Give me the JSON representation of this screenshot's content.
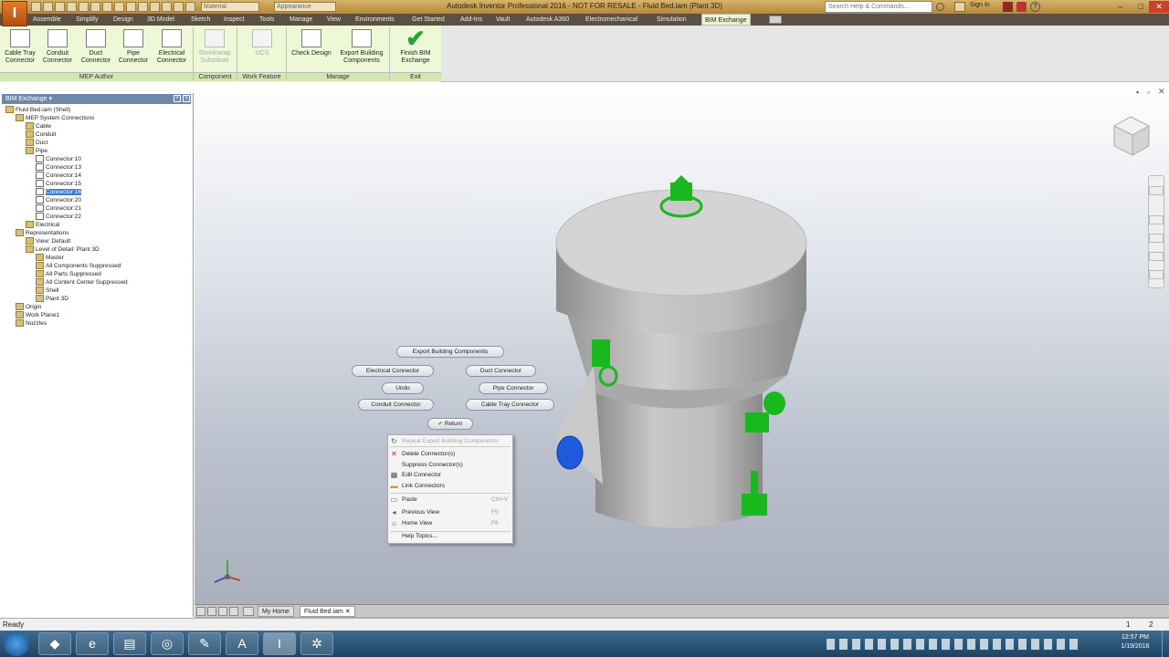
{
  "window": {
    "title": "Autodesk Inventor Professional 2016 - NOT FOR RESALE - Fluid Bed.iam (Plant 3D)",
    "app_icon": "I",
    "search_placeholder": "Search Help & Commands...",
    "sign_in": "Sign In",
    "quick_access": {
      "material": "Material",
      "appearance": "Appearance"
    }
  },
  "menu_tabs": [
    "Assemble",
    "Simplify",
    "Design",
    "3D Model",
    "Sketch",
    "Inspect",
    "Tools",
    "Manage",
    "View",
    "Environments",
    "Get Started",
    "Add-Ins",
    "Vault",
    "Autodesk A360",
    "Electromechanical",
    "Simulation",
    "BIM Exchange"
  ],
  "ribbon": {
    "buttons": [
      {
        "label": "Cable Tray Connector",
        "icon": "cable-tray-icon"
      },
      {
        "label": "Conduit Connector",
        "icon": "conduit-icon"
      },
      {
        "label": "Duct Connector",
        "icon": "duct-icon"
      },
      {
        "label": "Pipe Connector",
        "icon": "pipe-icon"
      },
      {
        "label": "Electrical Connector",
        "icon": "electrical-icon"
      },
      {
        "label": "Shrinkwrap Substitute",
        "icon": "shrinkwrap-icon"
      },
      {
        "label": "UCS",
        "icon": "ucs-icon"
      },
      {
        "label": "Check Design",
        "icon": "check-design-icon"
      },
      {
        "label": "Export Building Components",
        "icon": "export-icon"
      },
      {
        "label": "Finish BIM Exchange",
        "icon": "finish-check-icon"
      }
    ],
    "panels": [
      "MEP Author",
      "Component",
      "Work Feature",
      "Manage",
      "Exit"
    ]
  },
  "browser": {
    "header": "BIM Exchange",
    "tree": [
      {
        "label": "Fluid Bed.iam (Shell)",
        "depth": 0
      },
      {
        "label": "MEP System Connections",
        "depth": 1
      },
      {
        "label": "Cable",
        "depth": 2
      },
      {
        "label": "Conduit",
        "depth": 2
      },
      {
        "label": "Duct",
        "depth": 2
      },
      {
        "label": "Pipe",
        "depth": 2
      },
      {
        "label": "Connector:10",
        "depth": 3
      },
      {
        "label": "Connector:13",
        "depth": 3
      },
      {
        "label": "Connector:14",
        "depth": 3
      },
      {
        "label": "Connector:15",
        "depth": 3
      },
      {
        "label": "Connector:16",
        "depth": 3,
        "selected": true
      },
      {
        "label": "Connector:20",
        "depth": 3
      },
      {
        "label": "Connector:21",
        "depth": 3
      },
      {
        "label": "Connector:22",
        "depth": 3
      },
      {
        "label": "Electrical",
        "depth": 2
      },
      {
        "label": "Representations",
        "depth": 1
      },
      {
        "label": "View: Default",
        "depth": 2
      },
      {
        "label": "Level of Detail: Plant 3D",
        "depth": 2
      },
      {
        "label": "Master",
        "depth": 3
      },
      {
        "label": "All Components Suppressed",
        "depth": 3
      },
      {
        "label": "All Parts Suppressed",
        "depth": 3
      },
      {
        "label": "All Content Center Suppressed",
        "depth": 3
      },
      {
        "label": "Shell",
        "depth": 3
      },
      {
        "label": "Plant 3D",
        "depth": 3
      },
      {
        "label": "Origin",
        "depth": 1
      },
      {
        "label": "Work Plane1",
        "depth": 1
      },
      {
        "label": "Nozzles",
        "depth": 1
      }
    ]
  },
  "marking_menu": {
    "export": "Export Building Components",
    "electrical": "Electrical Connector",
    "duct": "Duct Connector",
    "undo": "Undo",
    "pipe": "Pipe Connector",
    "conduit": "Conduit Connector",
    "cable": "Cable Tray Connector",
    "return": "Return"
  },
  "context_menu": [
    {
      "label": "Repeat Export Building Components",
      "shortcut": "",
      "disabled": true,
      "icon": "repeat-icon"
    },
    {
      "label": "Delete Connector(s)",
      "shortcut": "",
      "icon": "delete-x-icon"
    },
    {
      "label": "Suppress Connector(s)",
      "shortcut": ""
    },
    {
      "label": "Edit Connector",
      "shortcut": "",
      "icon": "edit-icon"
    },
    {
      "label": "Link Connectors",
      "shortcut": "",
      "icon": "link-icon"
    },
    {
      "label": "Paste",
      "shortcut": "Ctrl+V",
      "icon": "paste-icon"
    },
    {
      "label": "Previous View",
      "shortcut": "F5",
      "icon": "previous-view-icon"
    },
    {
      "label": "Home View",
      "shortcut": "F6",
      "icon": "home-view-icon"
    },
    {
      "label": "Help Topics...",
      "shortcut": ""
    }
  ],
  "doc_tabs": {
    "home": "My Home",
    "file": "Fluid Bed.iam"
  },
  "status": {
    "text": "Ready",
    "n1": "1",
    "n2": "2"
  },
  "clock": {
    "time": "12:57 PM",
    "date": "1/19/2016"
  },
  "colors": {
    "connector_green": "#19b81e",
    "connector_blue": "#1d5bdc",
    "title_bar": "#c9a057",
    "ribbon_green": "#eef8d6"
  }
}
